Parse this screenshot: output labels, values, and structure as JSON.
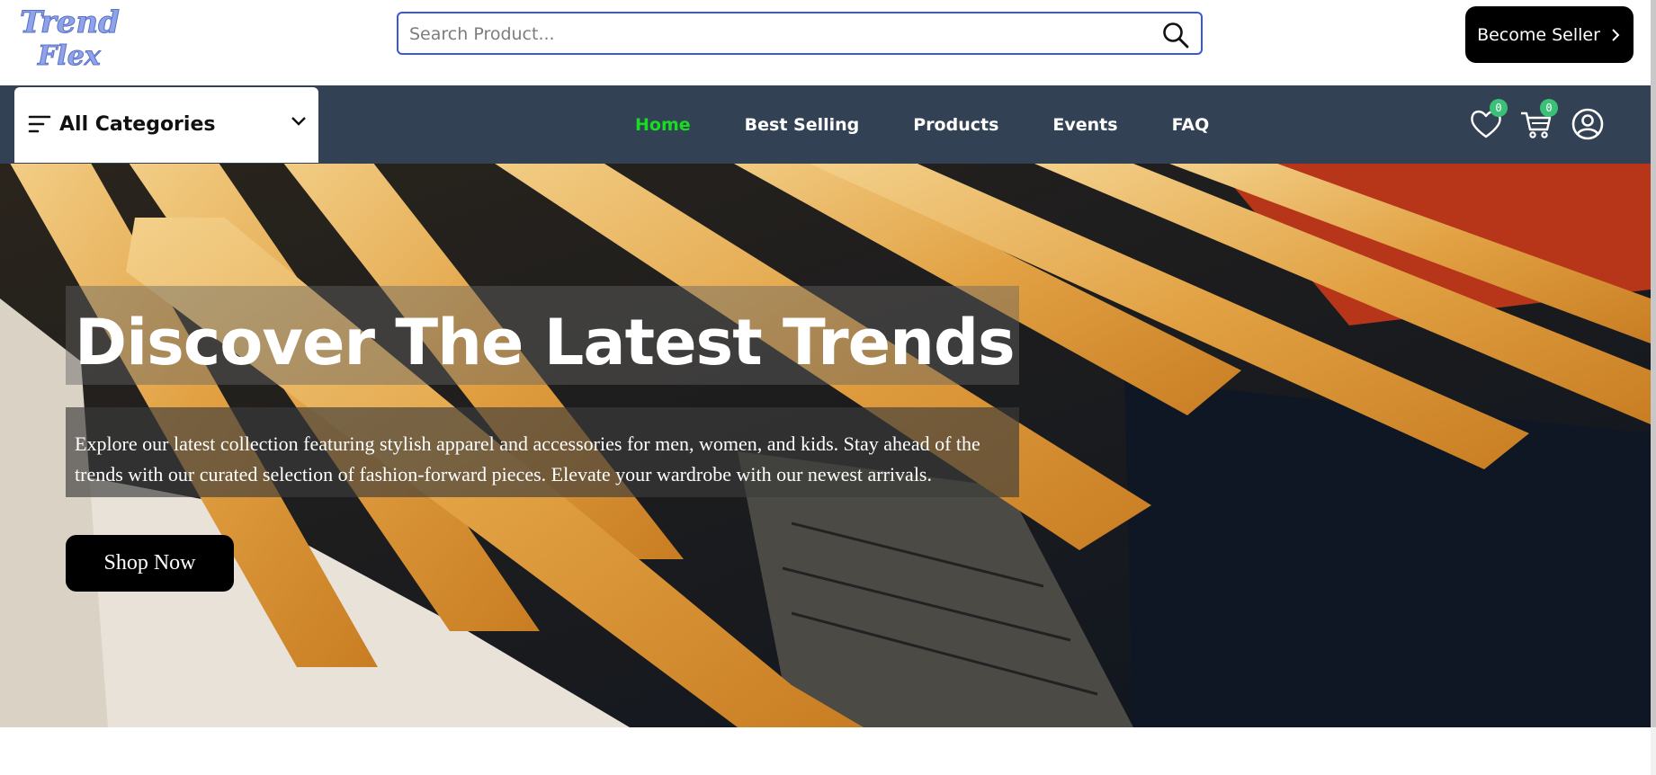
{
  "header": {
    "logo_text": "Trend Flex",
    "search": {
      "placeholder": "Search Product...",
      "value": ""
    },
    "search_icon": "search-icon",
    "become_seller_label": "Become Seller",
    "become_seller_icon": "chevron-right-icon"
  },
  "navbar": {
    "categories_label": "All Categories",
    "categories_icon": "menu-icon",
    "categories_chevron": "chevron-down-icon",
    "links": [
      {
        "label": "Home",
        "active": true
      },
      {
        "label": "Best Selling",
        "active": false
      },
      {
        "label": "Products",
        "active": false
      },
      {
        "label": "Events",
        "active": false
      },
      {
        "label": "FAQ",
        "active": false
      }
    ],
    "wishlist_count": "0",
    "cart_count": "0",
    "icons": [
      "heart-icon",
      "cart-icon",
      "profile-icon"
    ]
  },
  "hero": {
    "headline": "Discover The Latest Trends",
    "description": "Explore our latest collection featuring stylish apparel and accessories for men, women, and kids. Stay ahead of the trends with our curated selection of fashion-forward pieces. Elevate your wardrobe with our newest arrivals.",
    "cta_label": "Shop Now"
  },
  "colors": {
    "navbar_bg": "#334155",
    "active_link": "#17dd1f",
    "badge": "#3bc177",
    "search_border": "#3957db",
    "button_bg": "#000000"
  }
}
